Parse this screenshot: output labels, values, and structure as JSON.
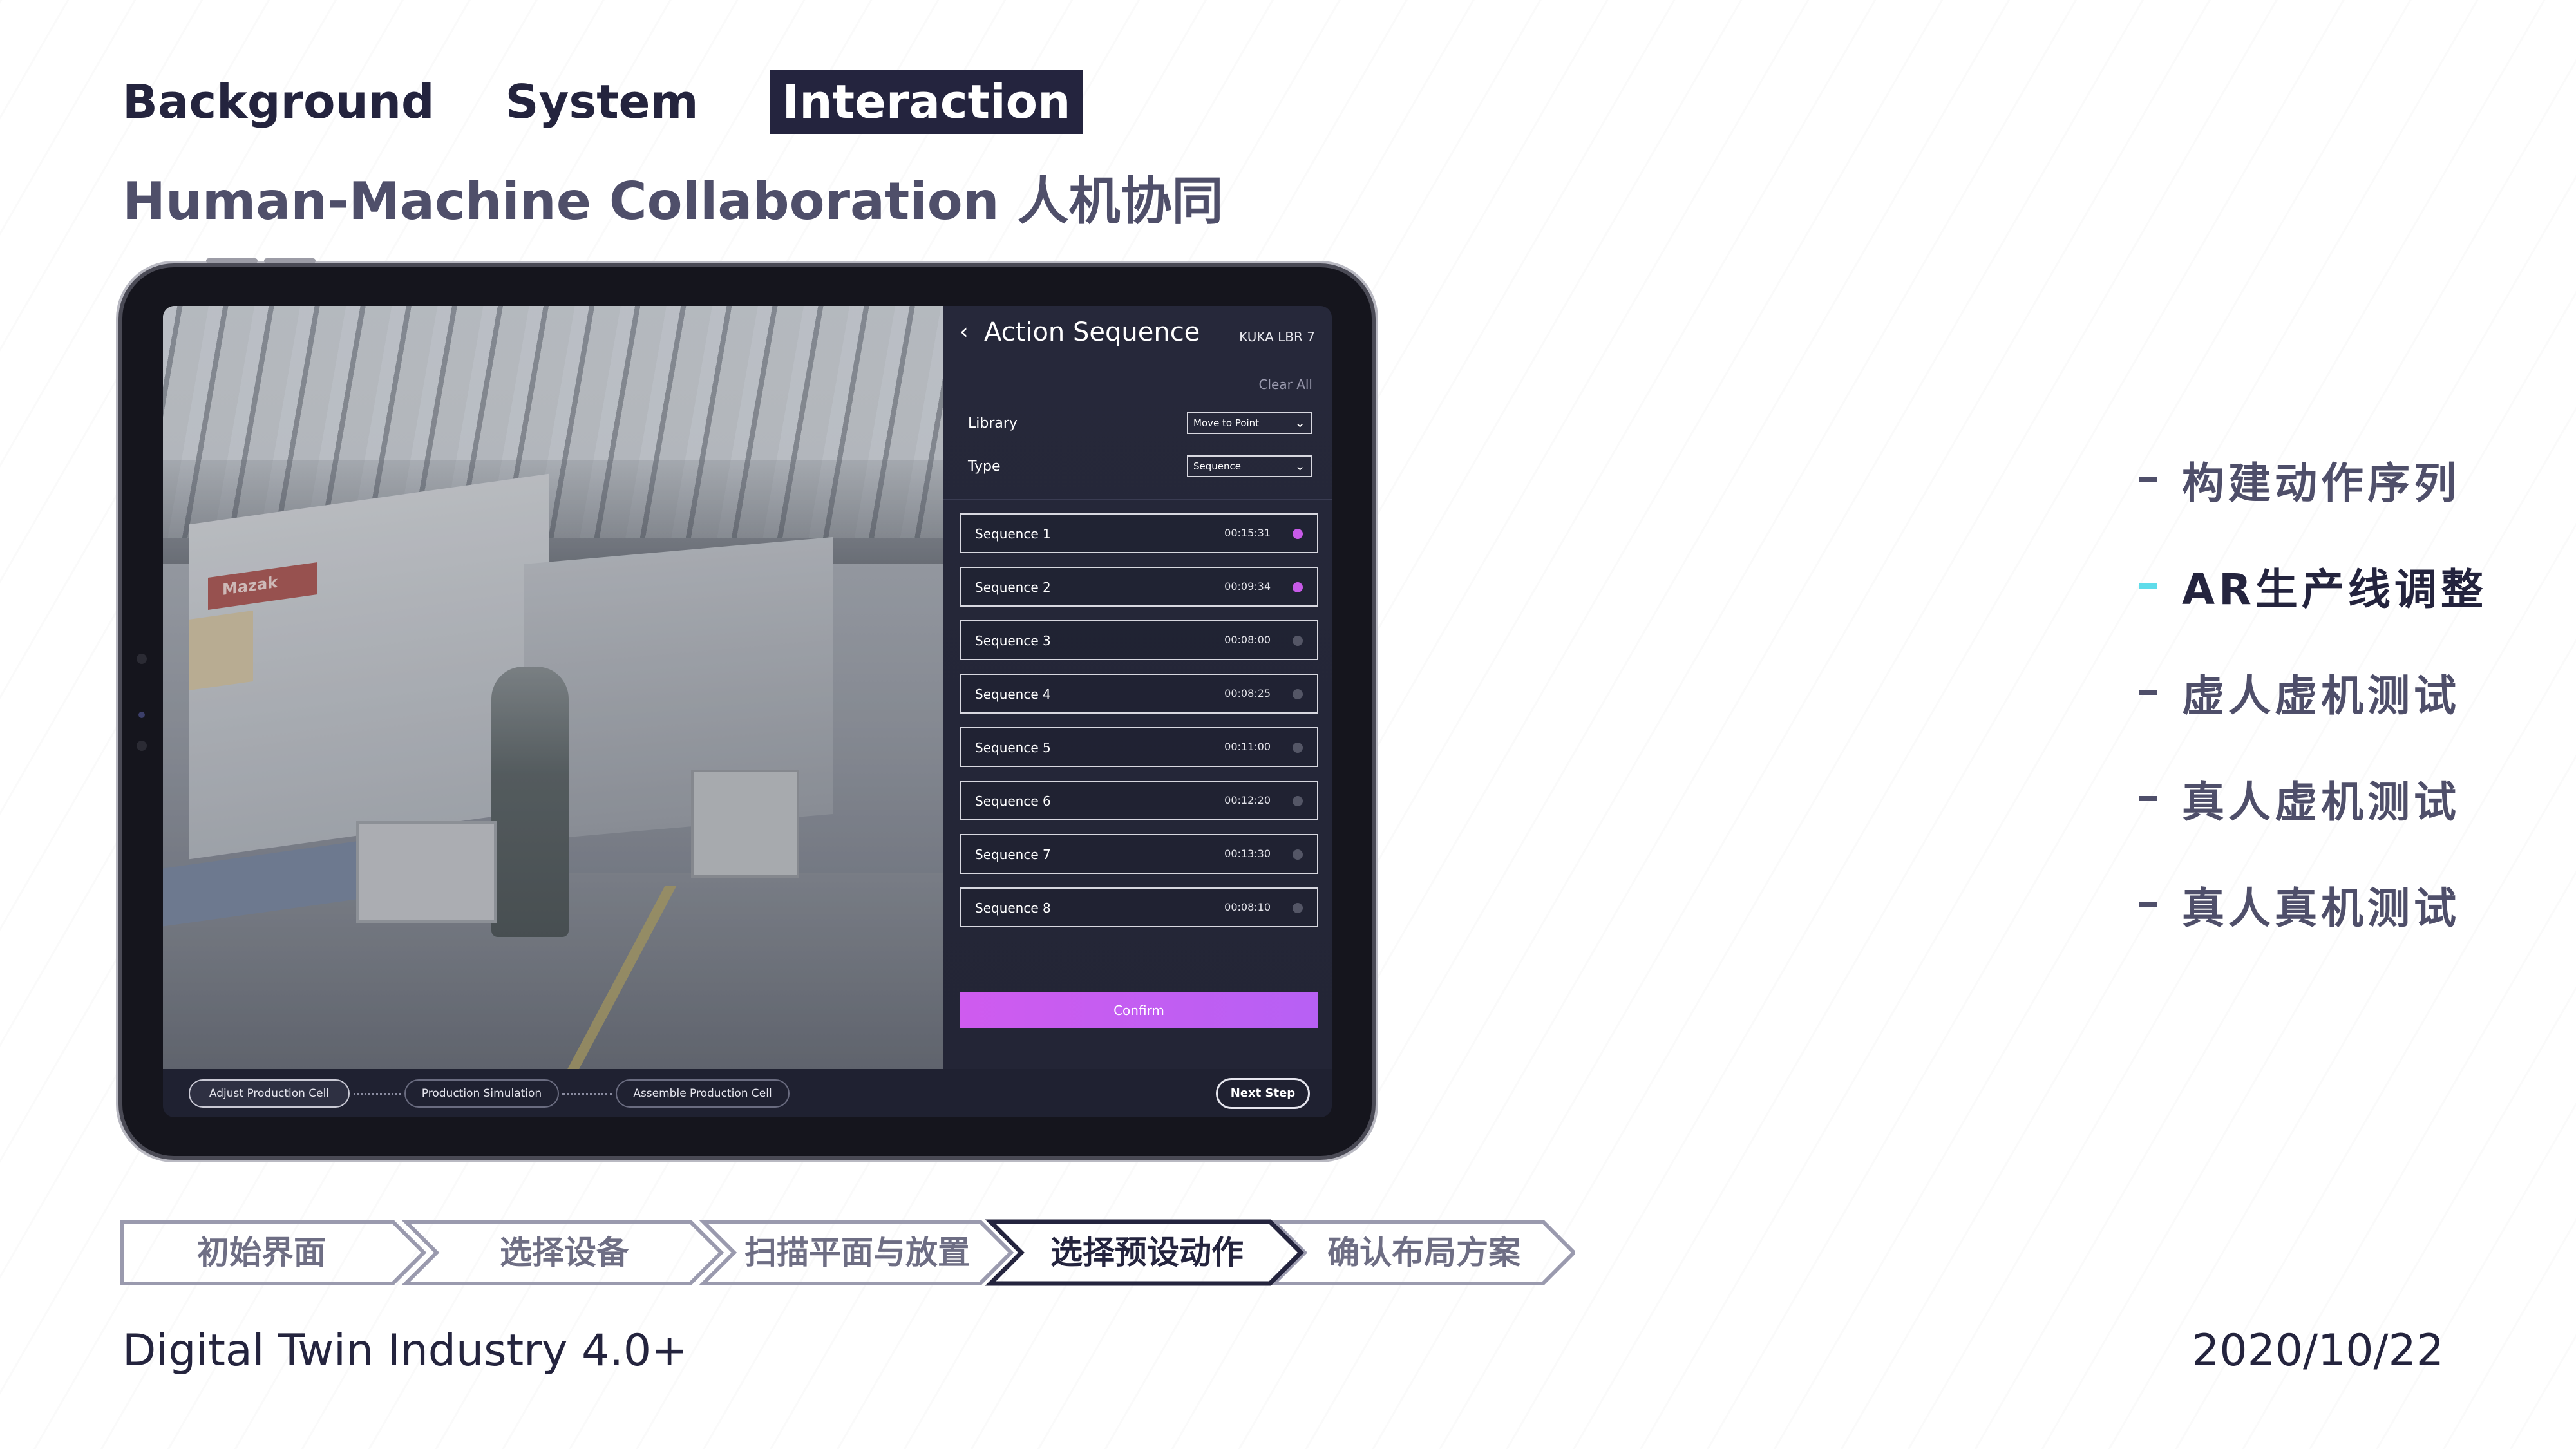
{
  "nav": {
    "items": [
      {
        "label": "Background",
        "active": false
      },
      {
        "label": "System",
        "active": false
      },
      {
        "label": "Interaction",
        "active": true
      }
    ]
  },
  "subtitle": "Human-Machine Collaboration 人机协同",
  "tablet": {
    "panel": {
      "back_glyph": "‹",
      "title": "Action Sequence",
      "device": "KUKA LBR 7",
      "clear_all": "Clear All",
      "library_label": "Library",
      "library_value": "Move to Point",
      "type_label": "Type",
      "type_value": "Sequence",
      "sequences": [
        {
          "name": "Sequence 1",
          "time": "00:15:31",
          "selected": true
        },
        {
          "name": "Sequence 2",
          "time": "00:09:34",
          "selected": true
        },
        {
          "name": "Sequence 3",
          "time": "00:08:00",
          "selected": false
        },
        {
          "name": "Sequence 4",
          "time": "00:08:25",
          "selected": false
        },
        {
          "name": "Sequence 5",
          "time": "00:11:00",
          "selected": false
        },
        {
          "name": "Sequence 6",
          "time": "00:12:20",
          "selected": false
        },
        {
          "name": "Sequence 7",
          "time": "00:13:30",
          "selected": false
        },
        {
          "name": "Sequence 8",
          "time": "00:08:10",
          "selected": false
        }
      ],
      "confirm_label": "Confirm"
    },
    "bottom_bar": {
      "steps": [
        {
          "label": "Adjust Production Cell",
          "active": true
        },
        {
          "label": "Production Simulation",
          "active": false
        },
        {
          "label": "Assemble Production Cell",
          "active": false
        }
      ],
      "next_label": "Next Step"
    },
    "photo_sign_text": "Mazak"
  },
  "right_list": {
    "items": [
      {
        "label": "构建动作序列",
        "active": false
      },
      {
        "label": "AR生产线调整",
        "active": true
      },
      {
        "label": "虚人虚机测试",
        "active": false
      },
      {
        "label": "真人虚机测试",
        "active": false
      },
      {
        "label": "真人真机测试",
        "active": false
      }
    ]
  },
  "flow": {
    "steps": [
      {
        "label": "初始界面",
        "active": false
      },
      {
        "label": "选择设备",
        "active": false
      },
      {
        "label": "扫描平面与放置",
        "active": false
      },
      {
        "label": "选择预设动作",
        "active": true
      },
      {
        "label": "确认布局方案",
        "active": false
      }
    ]
  },
  "footer": {
    "left": "Digital Twin Industry 4.0+",
    "right": "2020/10/22"
  },
  "colors": {
    "ink": "#24243e",
    "muted": "#4f4f6a",
    "accent_cyan": "#5fdcea",
    "accent_purple": "#c75ae8"
  }
}
